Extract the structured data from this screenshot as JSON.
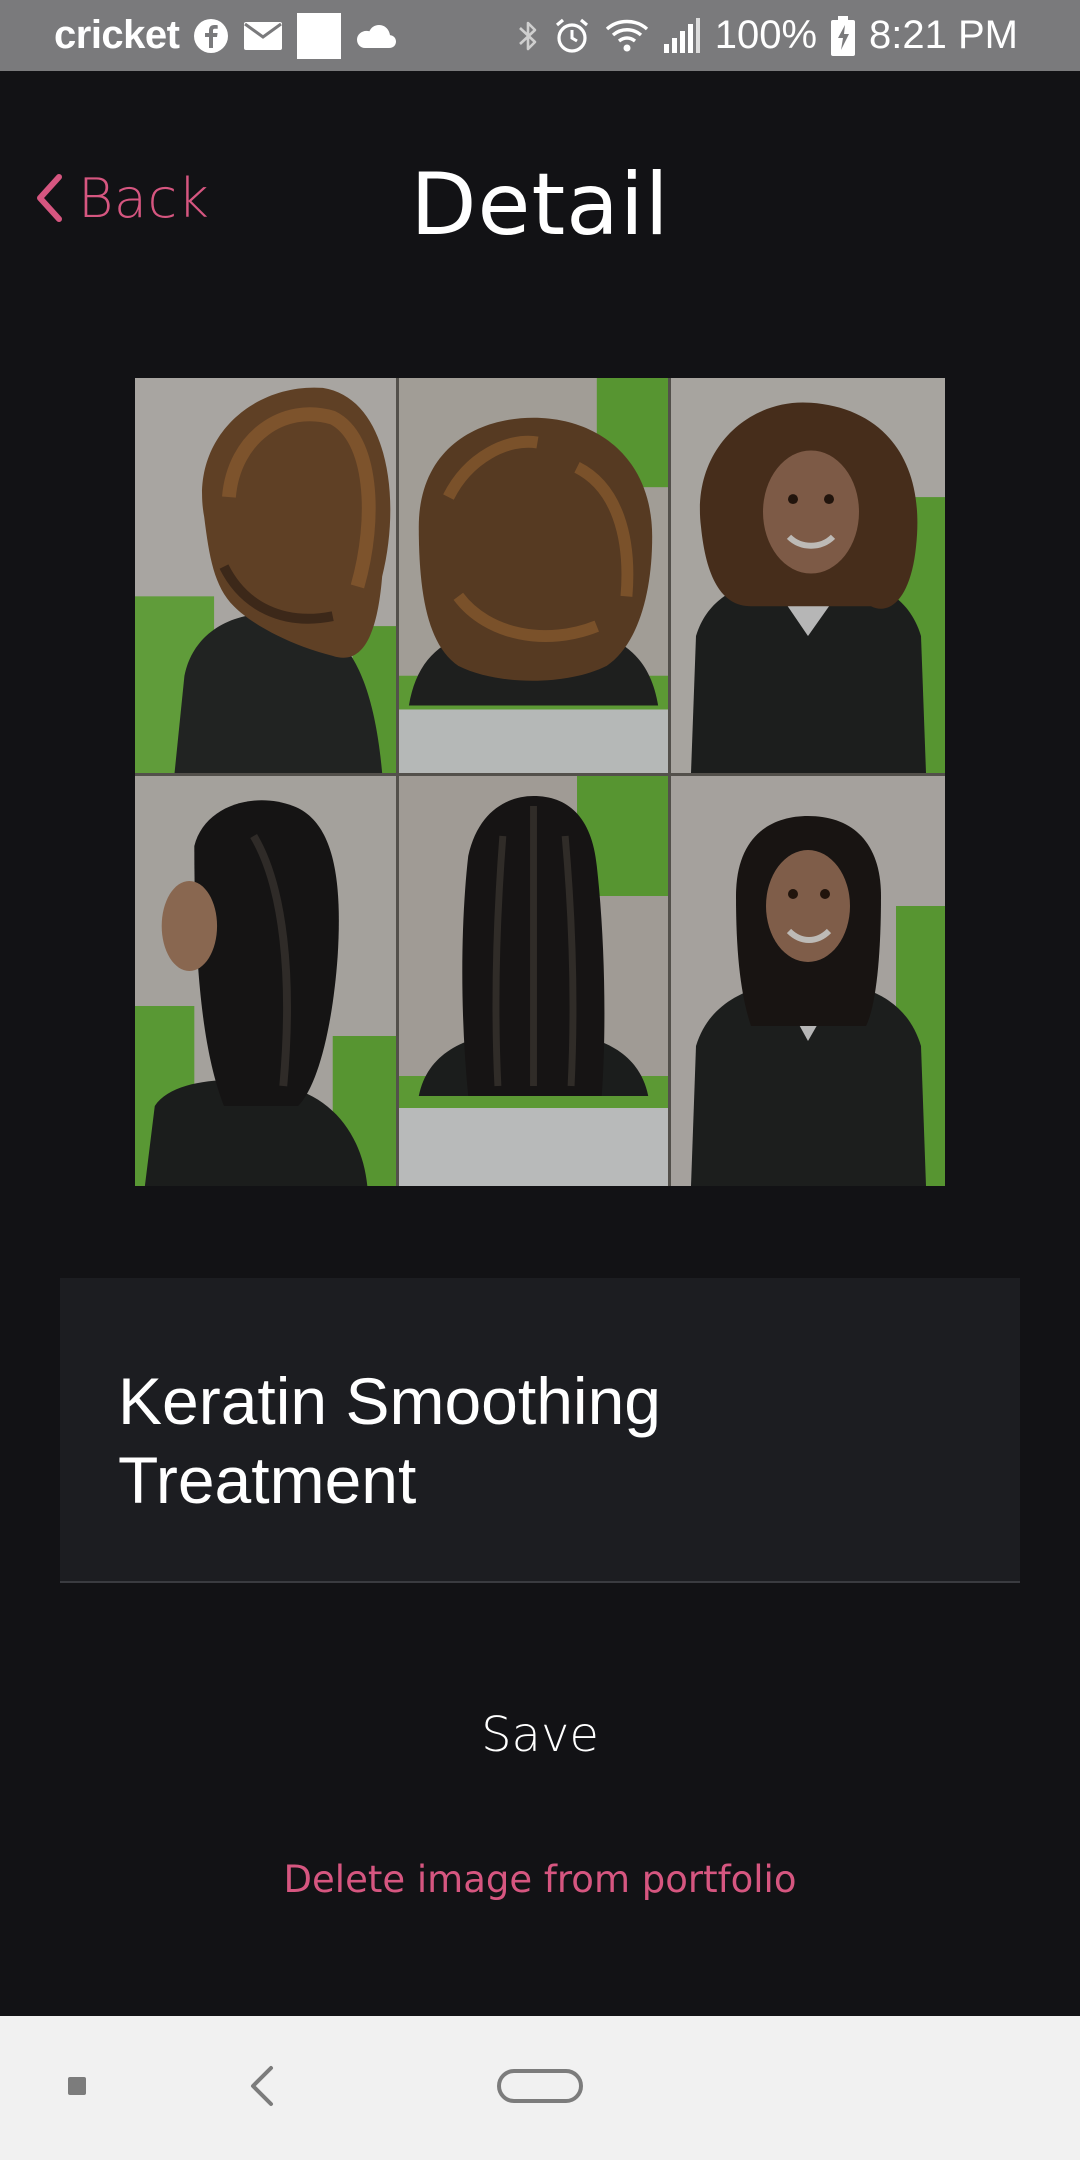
{
  "status_bar": {
    "carrier": "cricket",
    "battery": "100%",
    "time": "8:21 PM",
    "icons_left": [
      "facebook-icon",
      "mail-icon",
      "notification-square-icon",
      "cloud-icon"
    ],
    "icons_right": [
      "bluetooth-icon",
      "alarm-icon",
      "wifi-icon",
      "signal-icon",
      "battery-charging-icon"
    ]
  },
  "header": {
    "back_label": "Back",
    "title": "Detail"
  },
  "photo": {
    "icon": "before-after-hair-collage-image"
  },
  "title_field": {
    "value": "Keratin Smoothing Treatment"
  },
  "actions": {
    "save_label": "Save",
    "delete_label": "Delete image from portfolio"
  },
  "nav_bar": {
    "icons": [
      "recent-apps-icon",
      "back-icon",
      "home-icon"
    ]
  },
  "colors": {
    "accent": "#d65680",
    "background": "#121215",
    "field_background": "#1c1d21",
    "status_bar": "#7a7a7c",
    "nav_bar": "#f1f1f1"
  }
}
